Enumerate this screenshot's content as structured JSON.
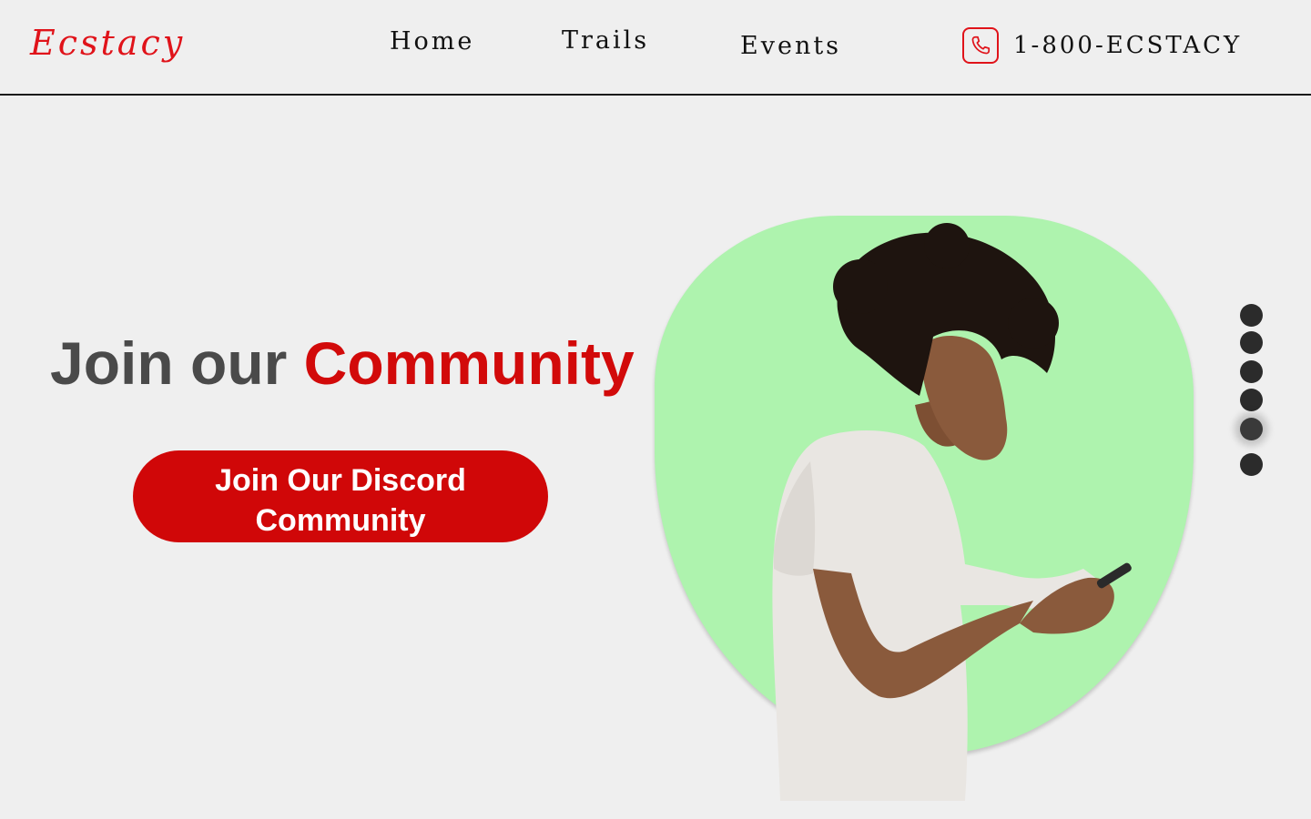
{
  "header": {
    "logo": "Ecstacy",
    "nav": {
      "home": "Home",
      "trails": "Trails",
      "events": "Events"
    },
    "phone_icon": "phone-icon",
    "phone": "1-800-ECSTACY"
  },
  "hero": {
    "title_part1": "Join our ",
    "title_part2": "Community",
    "cta_label": "Join Our Discord Community",
    "image": "person-with-phone-photo"
  },
  "carousel": {
    "dot_count": 6,
    "active_index": 4
  },
  "colors": {
    "brand_red": "#d00708",
    "logo_red": "#e0131a",
    "blob_green": "#aef3ae",
    "background": "#efefef",
    "title_gray": "#4a4a4a"
  }
}
